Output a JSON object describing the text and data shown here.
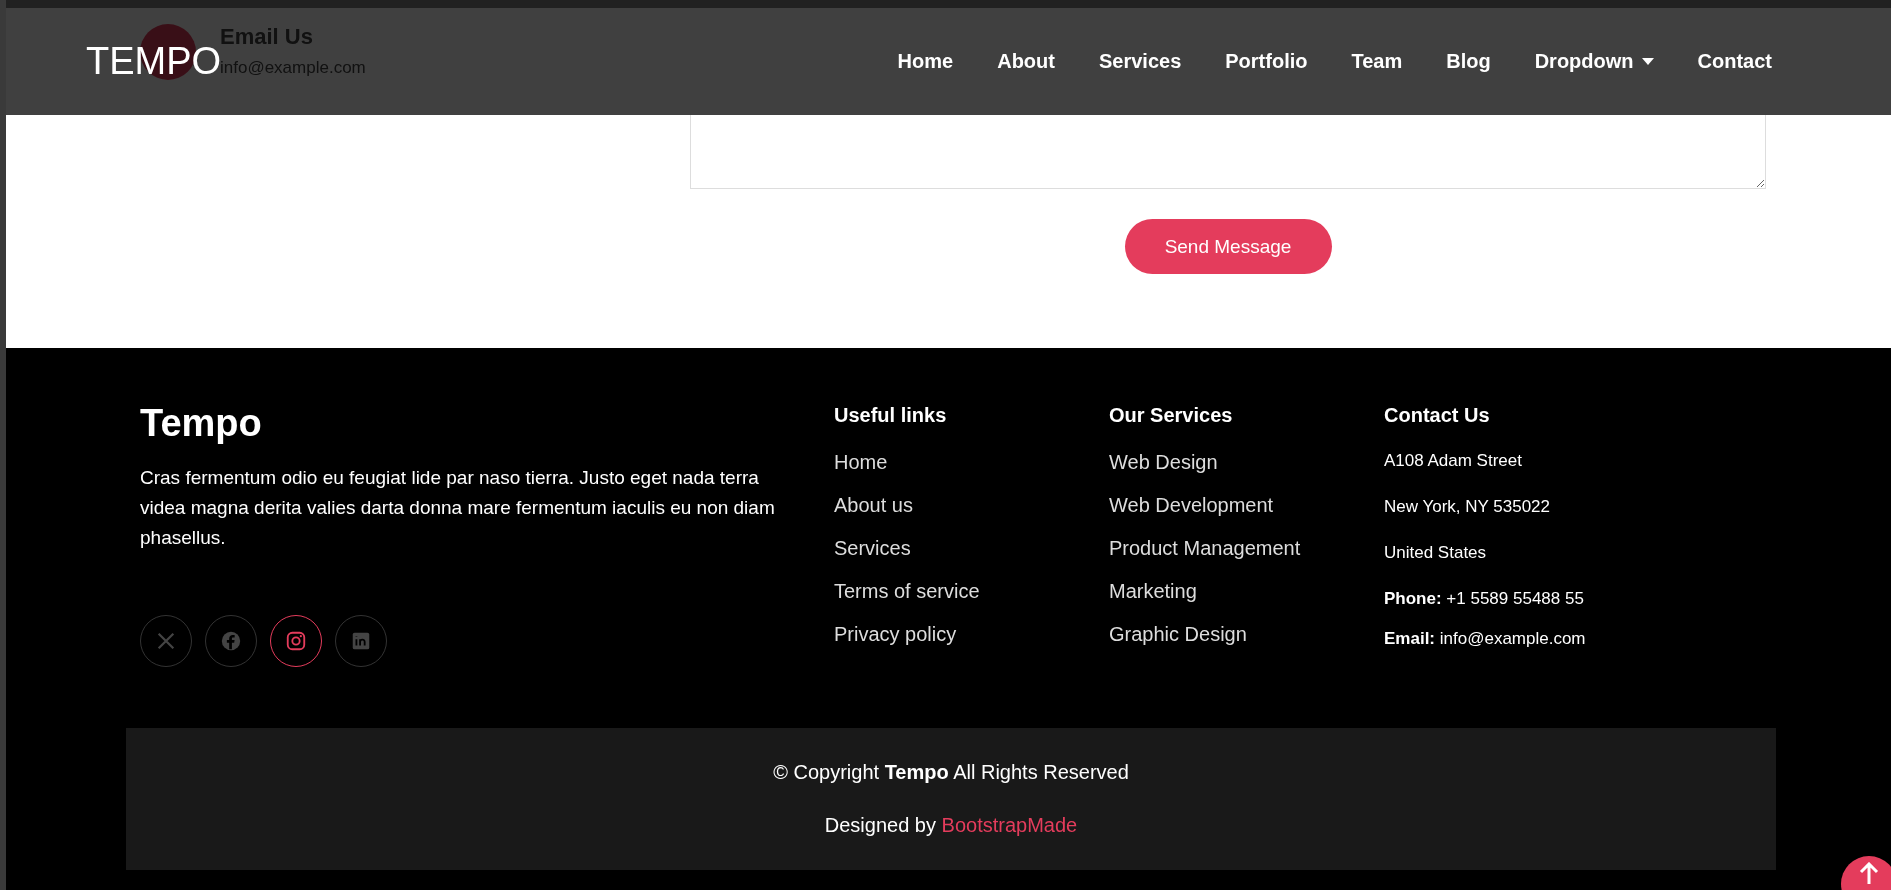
{
  "header": {
    "logo": "TEMPO",
    "nav": [
      {
        "label": "Home",
        "kind": "link"
      },
      {
        "label": "About",
        "kind": "link"
      },
      {
        "label": "Services",
        "kind": "link"
      },
      {
        "label": "Portfolio",
        "kind": "link"
      },
      {
        "label": "Team",
        "kind": "link"
      },
      {
        "label": "Blog",
        "kind": "link"
      },
      {
        "label": "Dropdown",
        "kind": "dropdown"
      },
      {
        "label": "Contact",
        "kind": "link"
      }
    ]
  },
  "contact_info": {
    "title": "Email Us",
    "value": "info@example.com"
  },
  "form": {
    "submit": "Send Message"
  },
  "footer": {
    "brand": "Tempo",
    "about": "Cras fermentum odio eu feugiat lide par naso tierra. Justo eget nada terra videa magna derita valies darta donna mare fermentum iaculis eu non diam phasellus.",
    "social": [
      {
        "kind": "x",
        "active": false
      },
      {
        "kind": "facebook",
        "active": false
      },
      {
        "kind": "instagram",
        "active": true
      },
      {
        "kind": "linkedin",
        "active": false
      }
    ],
    "useful_links": {
      "title": "Useful links",
      "items": [
        "Home",
        "About us",
        "Services",
        "Terms of service",
        "Privacy policy"
      ]
    },
    "services": {
      "title": "Our Services",
      "items": [
        "Web Design",
        "Web Development",
        "Product Management",
        "Marketing",
        "Graphic Design"
      ]
    },
    "contact": {
      "title": "Contact Us",
      "address": [
        "A108 Adam Street",
        "New York, NY 535022",
        "United States"
      ],
      "phone": "**Phone:** +1 5589 55488 55",
      "email": "**Email:** info@example.com"
    },
    "copyright": "© Copyright **Tempo** All Rights Reserved",
    "credit": {
      "text": "Designed by",
      "link": "BootstrapMade"
    }
  }
}
